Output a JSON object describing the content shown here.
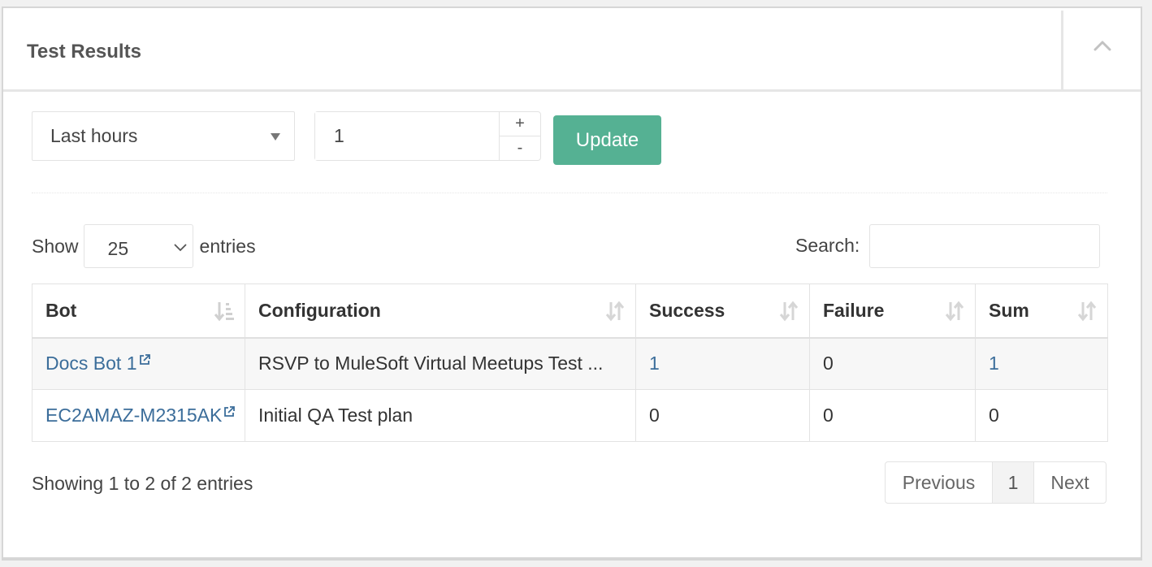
{
  "panel": {
    "title": "Test Results",
    "collapse_icon": "chevron-up-icon"
  },
  "filters": {
    "range_select": {
      "selected": "Last hours"
    },
    "amount": {
      "value": "1",
      "increment_label": "+",
      "decrement_label": "-"
    },
    "update_label": "Update",
    "accent_color": "#55b193"
  },
  "table_controls": {
    "show_label": "Show",
    "page_length": "25",
    "entries_label": "entries",
    "search_label": "Search:",
    "search_value": ""
  },
  "table": {
    "columns": [
      {
        "label": "Bot",
        "sort_icon": "sort-amount-asc-icon"
      },
      {
        "label": "Configuration",
        "sort_icon": "sort-icon"
      },
      {
        "label": "Success",
        "sort_icon": "sort-icon"
      },
      {
        "label": "Failure",
        "sort_icon": "sort-icon"
      },
      {
        "label": "Sum",
        "sort_icon": "sort-icon"
      }
    ],
    "rows": [
      {
        "bot": "Docs Bot 1",
        "configuration": "RSVP to MuleSoft Virtual Meetups Test ...",
        "success": "1",
        "failure": "0",
        "sum": "1"
      },
      {
        "bot": "EC2AMAZ-M2315AK",
        "configuration": "Initial QA Test plan",
        "success": "0",
        "failure": "0",
        "sum": "0"
      }
    ],
    "link_color": "#3b6d9a"
  },
  "footer": {
    "info": "Showing 1 to 2 of 2 entries",
    "pagination": {
      "previous": "Previous",
      "current": "1",
      "next": "Next"
    }
  }
}
